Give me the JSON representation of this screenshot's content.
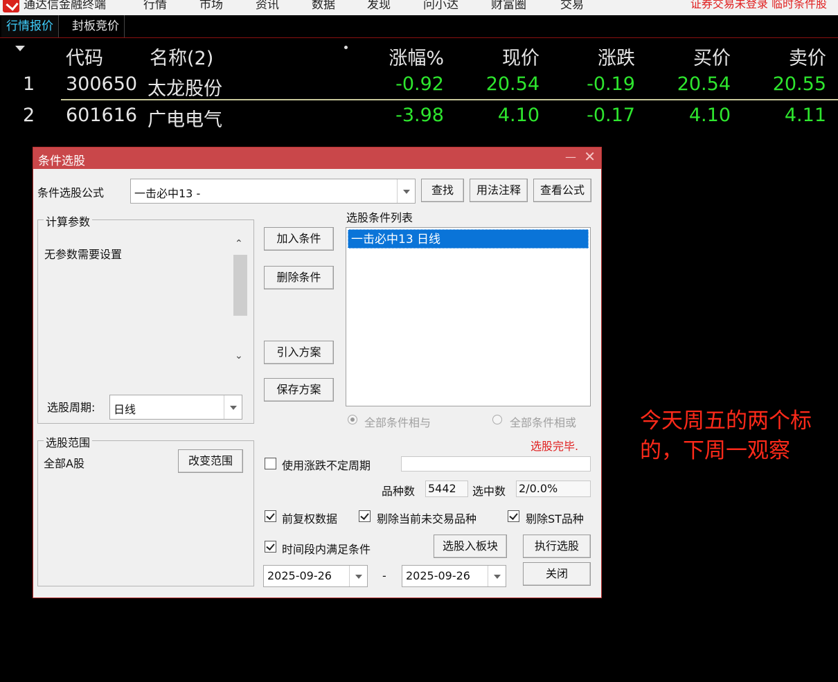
{
  "menubar": {
    "app_name": "通达信金融终端",
    "items": [
      "行情",
      "市场",
      "资讯",
      "数据",
      "发现",
      "问小达",
      "财富圈",
      "交易"
    ],
    "status_text": "证券交易未登录  临时条件股"
  },
  "tabs": [
    {
      "label": "行情报价",
      "active": true
    },
    {
      "label": "封板竞价",
      "active": false
    }
  ],
  "table": {
    "headers": {
      "code": "代码",
      "name": "名称(2)",
      "pct": "涨幅%",
      "price": "现价",
      "change": "涨跌",
      "bid": "买价",
      "ask": "卖价"
    },
    "rows": [
      {
        "index": "1",
        "code": "300650",
        "name": "太龙股份",
        "pct": "-0.92",
        "price": "20.54",
        "change": "-0.19",
        "bid": "20.54",
        "ask": "20.55"
      },
      {
        "index": "2",
        "code": "601616",
        "name": "广电电气",
        "pct": "-3.98",
        "price": "4.10",
        "change": "-0.17",
        "bid": "4.10",
        "ask": "4.11"
      }
    ]
  },
  "dialog": {
    "title": "条件选股",
    "formula_label": "条件选股公式",
    "formula_value": "一击必中13  -",
    "buttons": {
      "find": "查找",
      "usage": "用法注释",
      "view_formula": "查看公式",
      "add_condition": "加入条件",
      "delete_condition": "删除条件",
      "import_plan": "引入方案",
      "save_plan": "保存方案",
      "change_range": "改变范围",
      "to_block": "选股入板块",
      "execute": "执行选股",
      "close": "关闭"
    },
    "params_group": "计算参数",
    "params_text": "无参数需要设置",
    "period_label": "选股周期:",
    "period_value": "日线",
    "condition_list_label": "选股条件列表",
    "condition_items": [
      "一击必中13  日线"
    ],
    "radio_and": "全部条件相与",
    "radio_or": "全部条件相或",
    "status": "选股完毕.",
    "range_group": "选股范围",
    "range_value": "全部A股",
    "uncertain_period_label": "使用涨跌不定周期",
    "count_label": "品种数",
    "count_value": "5442",
    "selected_label": "选中数",
    "selected_value": "2/0.0%",
    "check_fq": "前复权数据",
    "check_untraded": "剔除当前未交易品种",
    "check_st": "剔除ST品种",
    "check_period": "时间段内满足条件",
    "date_from": "2025-09-26",
    "date_sep": "-",
    "date_to": "2025-09-26"
  },
  "annotation": {
    "line1": "今天周五的两个标",
    "line2": "的，下周一观察"
  },
  "colors": {
    "up_down_green": "#2ee62e",
    "selection_blue": "#0a74d8",
    "dialog_title_red": "#c9474a",
    "annotation_red": "#ff2a1a"
  }
}
